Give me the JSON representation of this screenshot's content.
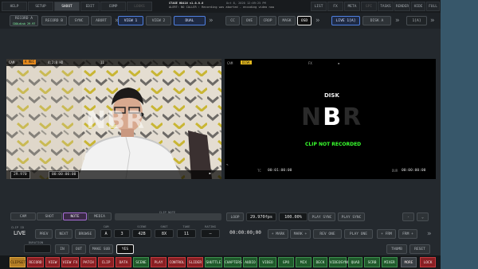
{
  "top_tabs": [
    "HELP",
    "SETUP",
    "SHOOT",
    "EDIT",
    "COMP",
    "LOOKS",
    "PLAYBACK",
    "LIST",
    "FX",
    "META",
    "GPI",
    "TASKS",
    "RENDER",
    "HIDE",
    "FULL"
  ],
  "status": {
    "line1": "STAGE HD416 v1.0.0.0",
    "line2": "READY TO RECORD",
    "line3": "Oct 8, 2020 12:09:25 PM",
    "line4": "RECORDING DISABLED - encoding video",
    "line5": "ALERT: NO CALLER : Recording was aborted - encoding video now"
  },
  "toolbar": {
    "record_a": "RECORD A",
    "record_a_sub": "COOLdisk 29.97",
    "record_b": "RECORD B",
    "sync": "SYNC",
    "abort": "ABORT",
    "view1": "VIEW 1",
    "view2": "VIEW 2",
    "dual": "DUAL",
    "cc": "CC",
    "ove": "OVE",
    "crop": "CROP",
    "mask": "MASK",
    "osd": "OSD",
    "live": "LIVE 1[A]",
    "disk": "DISK A",
    "cam": "1[A]"
  },
  "left_view": {
    "cam_tag": "CAM",
    "rec_tag": "A REC",
    "codec": "4:2:0 HD",
    "index": "11",
    "fps": "29.970",
    "tc": "00:00:00:00",
    "watermark": "NBR"
  },
  "right_view": {
    "cam_tag": "CAM",
    "disk_tag": "DISK",
    "fx_tag": "FX",
    "title": "DISK",
    "logo_n": "N",
    "logo_b": "B",
    "logo_r": "R",
    "note": "CLIP NOT RECORDED",
    "tc": "00:01:00:00",
    "tc2": "00:00:00:00"
  },
  "controls": {
    "cam": "CAM",
    "shot": "SHOT",
    "note": "NOTE",
    "media": "MEDIA",
    "clip_note_label": "CLIP NOTE",
    "loop": "LOOP",
    "fps": "29.970fps",
    "playrate": "100.00%",
    "sync_label": "SYNC",
    "play_sync_1": "PLAY SYNC",
    "play_sync_2": "PLAY SYNC",
    "clip_label": "CLIP ID",
    "live": "LIVE",
    "prev": "PREV",
    "next": "NEXT",
    "browse": "BROWSE",
    "cam_value": "A",
    "scene_value": "3",
    "scene2_value": "42B",
    "shot_value": "8X",
    "take_value": "11",
    "rating_value": "–",
    "timecode": "00:00:00;00",
    "mark": "+ MARK",
    "mark2": "MARK +",
    "rev_one": "REV ONE",
    "play_one": "PLAY ONE",
    "frm1": "+ FRM",
    "frm2": "FRM +",
    "duration_label": "DURATION",
    "in": "IN",
    "out": "OUT",
    "make_sub": "MAKE SUB",
    "yes": "YES",
    "thumb": "THUMB",
    "reset": "RESET"
  },
  "bottom_tabs": [
    "CLIPSET",
    "RECORD",
    "VIEW",
    "VIEW FX",
    "PATCH",
    "CLIP",
    "DATA",
    "SCENE",
    "PLAY",
    "CONTROL",
    "SLIDER",
    "SHUTTLE",
    "CHAPTERS",
    "AUDIO",
    "VIDEO OUT",
    "GPO OUT",
    "MIX OUT",
    "DECK",
    "VIDEOSYNC",
    "QUAD",
    "SCRB",
    "MIXER",
    "MORE",
    "LOCK"
  ],
  "colors": {
    "accent_blue": "#4f7fe0",
    "red_tab": "#8a1f23",
    "green_text": "#39ff2e",
    "side": "#37576a"
  }
}
